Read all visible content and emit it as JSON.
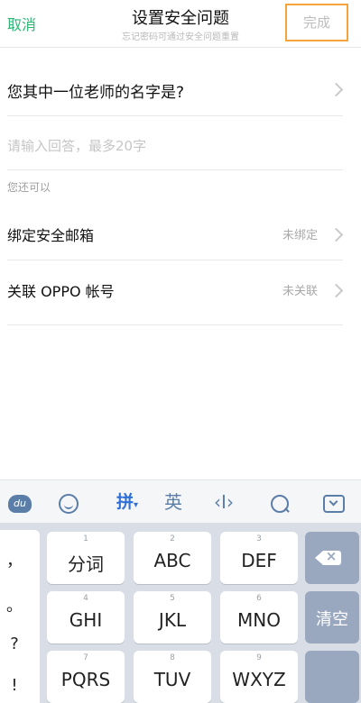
{
  "header": {
    "cancel_label": "取消",
    "title": "设置安全问题",
    "subtitle": "忘记密码可通过安全问题重置",
    "done_label": "完成"
  },
  "question": {
    "text": "您其中一位老师的名字是?"
  },
  "answer": {
    "placeholder": "请输入回答，最多20字"
  },
  "hint": "您还可以",
  "options": [
    {
      "label": "绑定安全邮箱",
      "status": "未绑定"
    },
    {
      "label": "关联 OPPO 帐号",
      "status": "未关联"
    }
  ],
  "keyboard": {
    "toolbar": {
      "face_badge": "du",
      "pinyin_label": "拼",
      "pinyin_caret": "▾",
      "english_label": "英",
      "cursor_label": "‹I›"
    },
    "punctuation": [
      "，",
      "。",
      "?",
      "!"
    ],
    "keys": [
      {
        "num": "1",
        "label": "分词"
      },
      {
        "num": "2",
        "label": "ABC"
      },
      {
        "num": "3",
        "label": "DEF"
      },
      {
        "num": "4",
        "label": "GHI"
      },
      {
        "num": "5",
        "label": "JKL"
      },
      {
        "num": "6",
        "label": "MNO"
      },
      {
        "num": "7",
        "label": "PQRS"
      },
      {
        "num": "8",
        "label": "TUV"
      },
      {
        "num": "9",
        "label": "WXYZ"
      }
    ],
    "clear_label": "清空"
  },
  "colors": {
    "accent": "#2bb673",
    "highlight_border": "#f3a53b",
    "keyboard_active": "#2f6fd6",
    "keyboard_bg": "#d9dee6"
  }
}
